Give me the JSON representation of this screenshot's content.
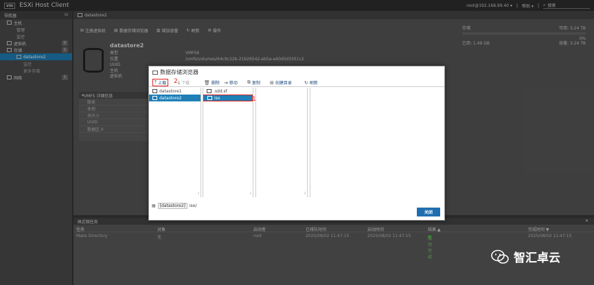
{
  "app": {
    "logo": "vm",
    "title": "ESXi Host Client"
  },
  "topbar": {
    "user": "root@192.168.99.40 ▾",
    "help": "帮助 ▾",
    "search_placeholder": "搜索"
  },
  "navigator": {
    "title": "导航器",
    "items": [
      {
        "label": "主机",
        "level": 1
      },
      {
        "label": "管理",
        "level": 2
      },
      {
        "label": "监控",
        "level": 2
      },
      {
        "label": "虚拟机",
        "level": 1,
        "badge": "0"
      },
      {
        "label": "存储",
        "level": 1,
        "badge": "1"
      },
      {
        "label": "datastore2",
        "level": 2,
        "selected": true
      },
      {
        "label": "监控",
        "level": 3
      },
      {
        "label": "更多存储",
        "level": 3
      },
      {
        "label": "网络",
        "level": 1,
        "badge": "1"
      }
    ]
  },
  "main": {
    "header": "datastore2",
    "toolbar": [
      "注册虚拟机",
      "数据存储浏览器",
      "增加容量",
      "刷新",
      "操作"
    ],
    "datastore": {
      "name": "datastore2",
      "props": [
        "类型",
        "位置",
        "UUID",
        "主机",
        "虚拟机"
      ],
      "vals": [
        "VMFS6",
        "/vmfs/volumes/64c9c22b-21b26542-eb5a-e40d5d3351c2",
        "",
        "",
        ""
      ]
    },
    "storage": {
      "label": "存储",
      "free": "可用: 3.24 TB",
      "pct": "0%",
      "used": "已用: 1.49 GB",
      "capacity": "容量: 3.24 TB"
    },
    "vmfs": {
      "title": "VMFS 详细信息",
      "rows": [
        "版本",
        "本地",
        "块大小",
        "UUID",
        "数据区 0"
      ]
    }
  },
  "tasks": {
    "title": "近期任务",
    "columns": [
      "任务",
      "对象",
      "启动者",
      "已排队时间",
      "启动时间",
      "结果 ▲",
      "完成时间 ▼"
    ],
    "rows": [
      [
        "Make Directory",
        "无",
        "root",
        "2025/08/02 11:47:15",
        "2025/08/02 11:47:15",
        "成功完成",
        "2025/08/02 11:47:15"
      ]
    ]
  },
  "dialog": {
    "title": "数据存储浏览器",
    "toolbar": [
      {
        "label": "上载",
        "icon": "upload-icon",
        "enabled": true
      },
      {
        "label": "下载",
        "icon": "download-icon",
        "enabled": false
      },
      {
        "label": "删除",
        "icon": "trash-icon",
        "enabled": true
      },
      {
        "label": "移动",
        "icon": "move-icon",
        "enabled": true
      },
      {
        "label": "复制",
        "icon": "copy-icon",
        "enabled": true
      },
      {
        "label": "创建目录",
        "icon": "new-folder-icon",
        "enabled": true
      },
      {
        "label": "刷新",
        "icon": "refresh-icon",
        "enabled": true
      }
    ],
    "datastores": [
      {
        "label": "datastore1",
        "selected": false
      },
      {
        "label": "datastore2",
        "selected": true
      }
    ],
    "folders": [
      {
        "label": ".sdd.sf",
        "selected": false
      },
      {
        "label": "iso",
        "selected": true
      }
    ],
    "path_prefix": "[datastore2]",
    "path_rest": "iso/",
    "close_label": "关闭",
    "step_markers": [
      "1",
      "2"
    ]
  },
  "watermark": {
    "text": "智汇卓云"
  },
  "colors": {
    "accent": "#1f7fb6",
    "highlight": "#e02020",
    "success": "#3fae3f"
  }
}
